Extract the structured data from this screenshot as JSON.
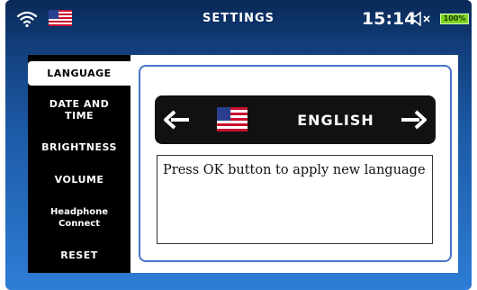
{
  "header": {
    "title": "SETTINGS",
    "time": "15:14",
    "battery": "100%",
    "icons": [
      "wifi-icon",
      "us-flag-icon",
      "speaker-mute-icon",
      "battery-icon"
    ]
  },
  "sidebar": {
    "items": [
      {
        "label": "LANGUAGE",
        "active": true
      },
      {
        "label": "DATE AND TIME",
        "lines": [
          "DATE AND",
          "TIME"
        ],
        "active": false
      },
      {
        "label": "BRIGHTNESS",
        "active": false
      },
      {
        "label": "VOLUME",
        "active": false
      },
      {
        "label": "Headphone Connect",
        "lines": [
          "Headphone",
          "Connect"
        ],
        "active": false
      },
      {
        "label": "RESET",
        "active": false
      }
    ]
  },
  "language": {
    "selected": "ENGLISH",
    "message": "Press OK button to apply new language"
  },
  "colors": {
    "accent_border": "#4a73c4",
    "battery_green": "#7ed321",
    "background_blue": "#1c5aa6"
  }
}
